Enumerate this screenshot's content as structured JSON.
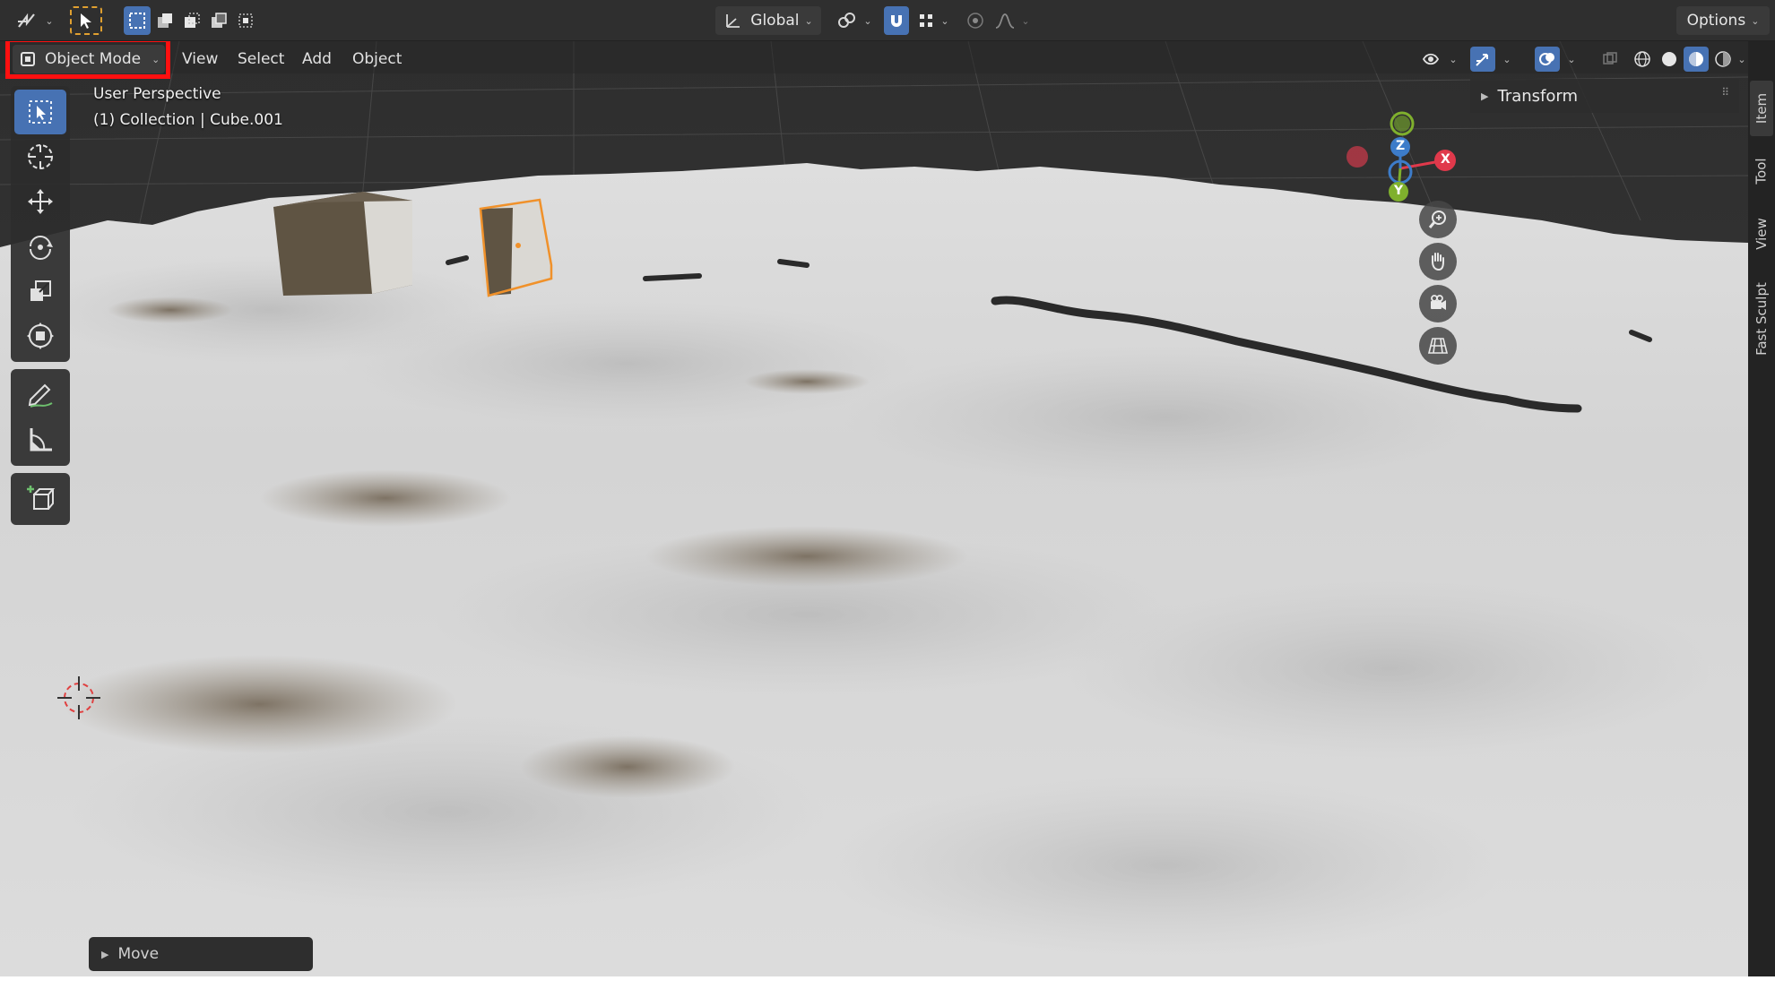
{
  "toolbar": {
    "transform_orientation": "Global",
    "options_label": "Options"
  },
  "header": {
    "mode": "Object Mode",
    "menus": [
      "View",
      "Select",
      "Add",
      "Object"
    ]
  },
  "viewport": {
    "perspective_label": "User Perspective",
    "collection_label": "(1) Collection | Cube.001"
  },
  "gizmo": {
    "axes": {
      "x": "X",
      "y": "Y",
      "z": "Z"
    },
    "colors": {
      "x": "#e0394b",
      "y": "#7fb02d",
      "z": "#3d7cc9"
    }
  },
  "sidebar": {
    "panel_title": "Transform",
    "tabs": [
      "Item",
      "Tool",
      "View",
      "Fast Sculpt"
    ]
  },
  "operator_panel": {
    "label": "Move"
  },
  "colors": {
    "accent": "#4772b3",
    "highlight": "#ff1010",
    "selection": "#f0912a"
  }
}
